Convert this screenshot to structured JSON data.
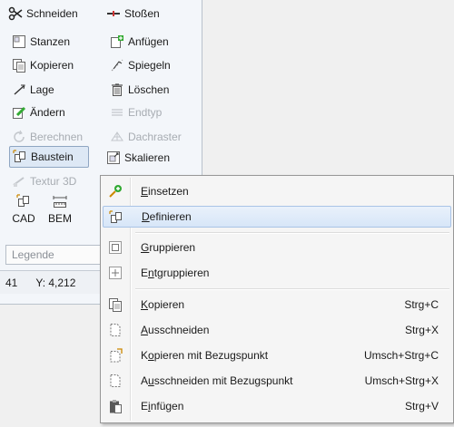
{
  "toolbar": {
    "items": [
      {
        "label": "Schneiden",
        "icon": "scissors-icon"
      },
      {
        "label": "Stoßen",
        "icon": "join-icon"
      },
      {
        "label": "Stanzen",
        "icon": "punch-icon"
      },
      {
        "label": "Anfügen",
        "icon": "append-icon"
      },
      {
        "label": "Kopieren",
        "icon": "copy-icon"
      },
      {
        "label": "Spiegeln",
        "icon": "mirror-icon"
      },
      {
        "label": "Lage",
        "icon": "position-icon"
      },
      {
        "label": "Löschen",
        "icon": "trash-icon"
      },
      {
        "label": "Ändern",
        "icon": "edit-icon"
      },
      {
        "label": "Endtyp",
        "icon": "endtype-icon"
      },
      {
        "label": "Berechnen",
        "icon": "calculate-icon"
      },
      {
        "label": "Dachraster",
        "icon": "roof-grid-icon"
      },
      {
        "label": "Baustein",
        "icon": "block-icon"
      },
      {
        "label": "Skalieren",
        "icon": "scale-icon"
      },
      {
        "label": "Textur 3D",
        "icon": "texture-icon"
      }
    ],
    "large_buttons": [
      {
        "label": "CAD",
        "icon": "cad-icon"
      },
      {
        "label": "BEM",
        "icon": "dimension-icon"
      }
    ],
    "legend_placeholder": "Legende",
    "status": {
      "left": "41",
      "y": "Y: 4,212"
    }
  },
  "context_menu": {
    "items": [
      {
        "pre": "",
        "u": "E",
        "post": "insetzen",
        "shortcut": ""
      },
      {
        "pre": "",
        "u": "D",
        "post": "efinieren",
        "shortcut": ""
      },
      {
        "pre": "",
        "u": "G",
        "post": "ruppieren",
        "shortcut": ""
      },
      {
        "pre": "E",
        "u": "n",
        "post": "tgruppieren",
        "shortcut": ""
      },
      {
        "pre": "",
        "u": "K",
        "post": "opieren",
        "shortcut": "Strg+C"
      },
      {
        "pre": "",
        "u": "A",
        "post": "usschneiden",
        "shortcut": "Strg+X"
      },
      {
        "pre": "K",
        "u": "o",
        "post": "pieren mit Bezugspunkt",
        "shortcut": "Umsch+Strg+C"
      },
      {
        "pre": "A",
        "u": "u",
        "post": "sschneiden mit Bezugspunkt",
        "shortcut": "Umsch+Strg+X"
      },
      {
        "pre": "E",
        "u": "i",
        "post": "nfügen",
        "shortcut": "Strg+V"
      }
    ]
  },
  "colors": {
    "highlight": "#d7e6f8",
    "panel": "#f3f6fa",
    "disabled": "#a7acb2"
  }
}
